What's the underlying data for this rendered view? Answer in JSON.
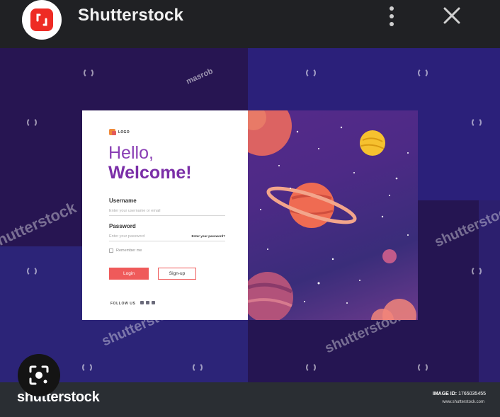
{
  "app": {
    "title": "Shutterstock"
  },
  "card": {
    "logo_text": "LOGO",
    "hello": "Hello,",
    "welcome": "Welcome!",
    "username_label": "Username",
    "username_placeholder": "Enter your username or email",
    "password_label": "Password",
    "password_placeholder": "Enter your password",
    "forgot": "Enter your password?",
    "remember": "Remember me",
    "login": "Login",
    "signup": "Sign-up",
    "follow": "FOLLOW US"
  },
  "watermarks": {
    "brand": "shutterstock",
    "author": "masrob"
  },
  "footer": {
    "brand": "shutterstock",
    "image_id_label": "IMAGE ID:",
    "image_id": "1765035455",
    "url": "www.shutterstock.com"
  },
  "colors": {
    "accent": "#ef5a5a",
    "heading_purple": "#7b2fa8",
    "app_red": "#ee2b24"
  },
  "icons": [
    "shutterstock-app-icon",
    "more-vert-icon",
    "close-icon",
    "lens-search-icon"
  ]
}
